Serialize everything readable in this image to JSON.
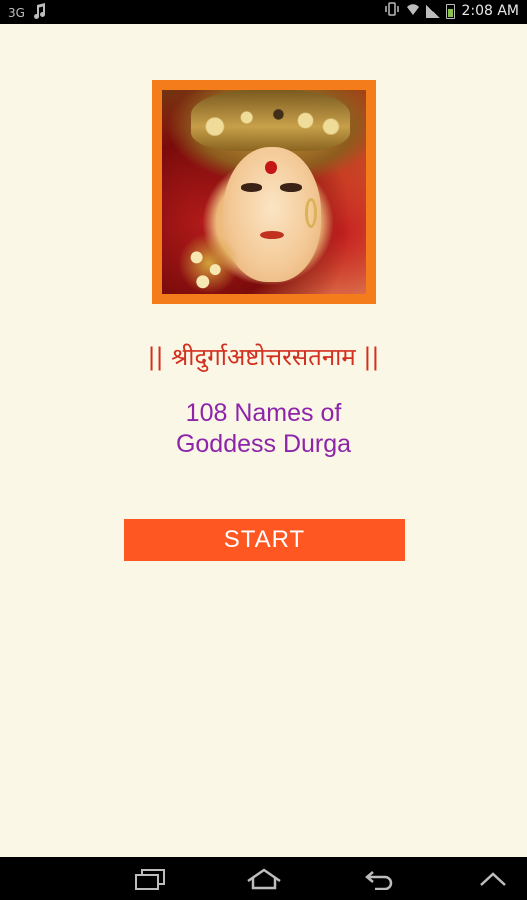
{
  "status_bar": {
    "time": "2:08 AM",
    "left_indicator": "3G",
    "icons": [
      "usb-icon",
      "music-note-icon",
      "vibrate-icon",
      "wifi-icon",
      "signal-icon",
      "battery-icon"
    ]
  },
  "main": {
    "image_subject": "goddess-durga-portrait",
    "sanskrit_title": "|| श्रीदुर्गाअष्टोत्तरसतनाम ||",
    "english_title_line1": "108 Names of",
    "english_title_line2": "Goddess Durga",
    "start_label": "START"
  },
  "navigation_bar": {
    "icons": [
      "recent-apps-icon",
      "home-icon",
      "back-icon",
      "menu-up-icon"
    ]
  },
  "colors": {
    "background": "#FAF7E6",
    "frame": "#F57C1A",
    "sanskrit_title": "#D32F1E",
    "english_title": "#8E24AA",
    "start_button": "#FF5722"
  }
}
